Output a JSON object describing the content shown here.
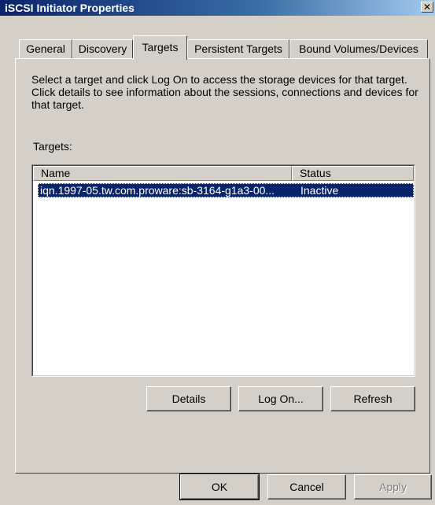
{
  "window": {
    "title": "iSCSI Initiator Properties",
    "close_glyph": "✕"
  },
  "tabs": [
    {
      "label": "General",
      "active": false
    },
    {
      "label": "Discovery",
      "active": false
    },
    {
      "label": "Targets",
      "active": true
    },
    {
      "label": "Persistent Targets",
      "active": false
    },
    {
      "label": "Bound Volumes/Devices",
      "active": false
    }
  ],
  "targets_tab": {
    "description": "Select a target and click Log On to access the storage devices for that target. Click details to see information about the sessions, connections and devices for that target.",
    "list_label": "Targets:",
    "columns": [
      "Name",
      "Status"
    ],
    "rows": [
      {
        "name": "iqn.1997-05.tw.com.proware:sb-3164-g1a3-00...",
        "status": "Inactive",
        "selected": true
      }
    ],
    "buttons": {
      "details": "Details",
      "log_on": "Log On...",
      "refresh": "Refresh"
    }
  },
  "footer": {
    "ok": "OK",
    "cancel": "Cancel",
    "apply": "Apply"
  },
  "colors": {
    "title_gradient_start": "#0a246a",
    "title_gradient_end": "#a6caf0",
    "selection": "#0a246a",
    "face": "#d4d0c8"
  }
}
